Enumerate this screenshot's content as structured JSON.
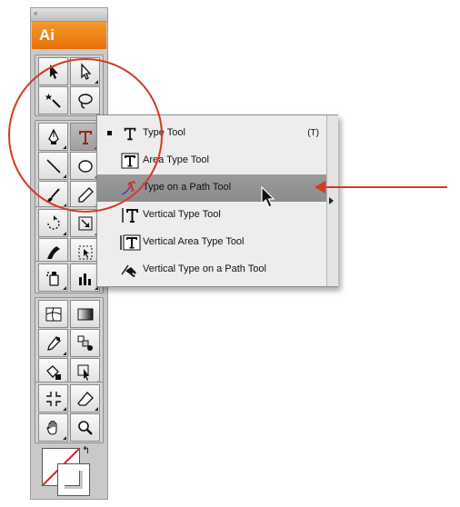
{
  "app": {
    "badge": "Ai",
    "grip_glyph": "«",
    "accent": "#ee8416",
    "annotation_color": "#d63a25"
  },
  "toolbar": {
    "tools": [
      {
        "name": "selection-tool",
        "icon": "arrow-icon"
      },
      {
        "name": "direct-selection-tool",
        "icon": "hollow-arrow-icon"
      },
      {
        "name": "magic-wand-tool",
        "icon": "magic-wand-icon"
      },
      {
        "name": "lasso-tool",
        "icon": "lasso-icon"
      },
      {
        "name": "pen-tool",
        "icon": "pen-icon"
      },
      {
        "name": "type-tool",
        "icon": "type-icon",
        "active": true
      },
      {
        "name": "line-segment-tool",
        "icon": "line-icon"
      },
      {
        "name": "ellipse-tool",
        "icon": "ellipse-icon"
      },
      {
        "name": "paintbrush-tool",
        "icon": "brush-icon"
      },
      {
        "name": "pencil-tool",
        "icon": "pencil-icon"
      },
      {
        "name": "rotate-tool",
        "icon": "rotate-icon"
      },
      {
        "name": "scale-tool",
        "icon": "scale-icon"
      },
      {
        "name": "warp-tool",
        "icon": "warp-icon"
      },
      {
        "name": "free-transform-tool",
        "icon": "free-transform-icon"
      },
      {
        "name": "symbol-sprayer-tool",
        "icon": "sprayer-icon"
      },
      {
        "name": "column-graph-tool",
        "icon": "graph-icon"
      },
      {
        "name": "mesh-tool",
        "icon": "mesh-icon"
      },
      {
        "name": "gradient-tool",
        "icon": "gradient-icon"
      },
      {
        "name": "eyedropper-tool",
        "icon": "eyedropper-icon"
      },
      {
        "name": "blend-tool",
        "icon": "blend-icon"
      },
      {
        "name": "live-paint-bucket-tool",
        "icon": "paint-bucket-icon"
      },
      {
        "name": "live-paint-selection-tool",
        "icon": "paint-selection-icon"
      },
      {
        "name": "slice-tool",
        "icon": "slice-icon"
      },
      {
        "name": "eraser-tool",
        "icon": "eraser-icon"
      },
      {
        "name": "hand-tool",
        "icon": "hand-icon"
      },
      {
        "name": "zoom-tool",
        "icon": "zoom-icon"
      }
    ]
  },
  "flyout": {
    "items": [
      {
        "label": "Type Tool",
        "shortcut": "(T)",
        "icon": "type-icon",
        "current": true
      },
      {
        "label": "Area Type Tool",
        "shortcut": "",
        "icon": "area-type-icon"
      },
      {
        "label": "Type on a Path Tool",
        "shortcut": "",
        "icon": "type-on-path-icon",
        "highlighted": true
      },
      {
        "label": "Vertical Type Tool",
        "shortcut": "",
        "icon": "vertical-type-icon"
      },
      {
        "label": "Vertical Area Type Tool",
        "shortcut": "",
        "icon": "vertical-area-type-icon"
      },
      {
        "label": "Vertical Type on a Path Tool",
        "shortcut": "",
        "icon": "vertical-type-on-path-icon"
      }
    ]
  }
}
